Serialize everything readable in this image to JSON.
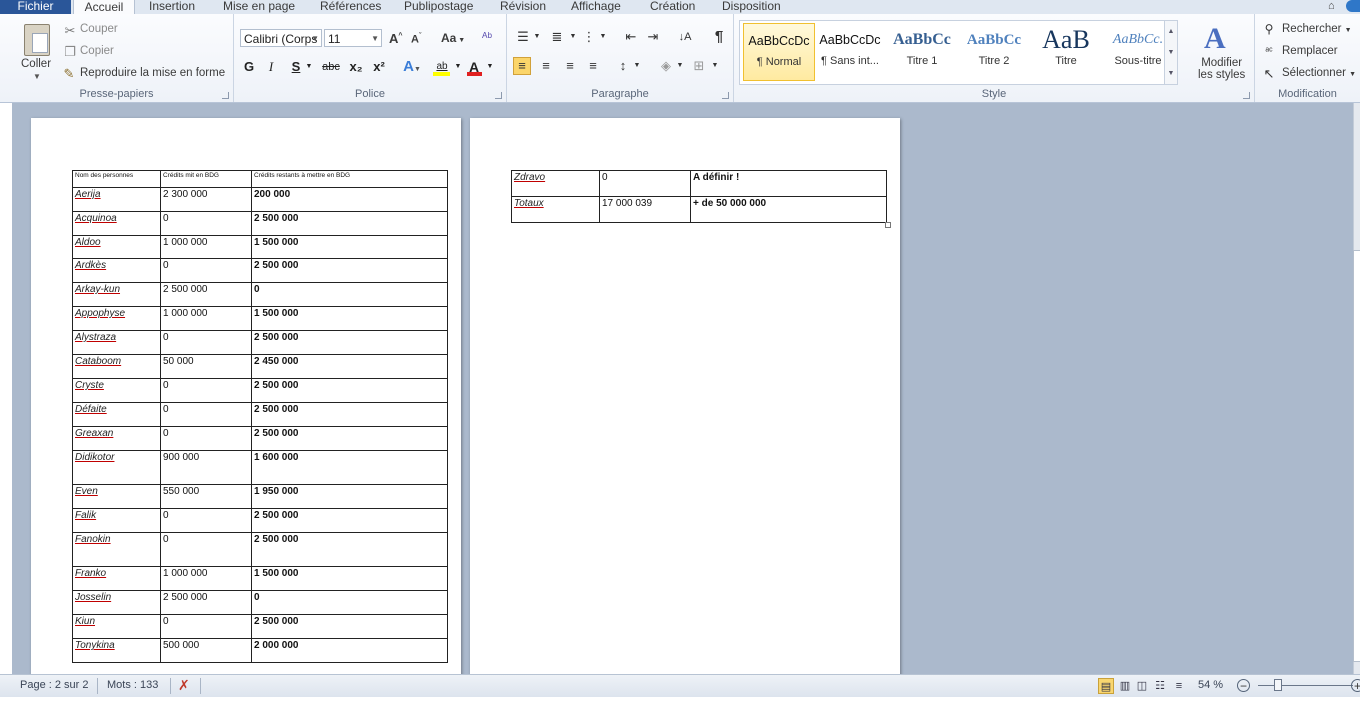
{
  "tabs": {
    "file": "Fichier",
    "home": "Accueil",
    "insert": "Insertion",
    "layout": "Mise en page",
    "references": "Références",
    "mailings": "Publipostage",
    "review": "Révision",
    "view": "Affichage",
    "creation": "Création",
    "disposition": "Disposition"
  },
  "clipboard": {
    "label": "Presse-papiers",
    "paste": "Coller",
    "cut": "Couper",
    "copy": "Copier",
    "format_painter": "Reproduire la mise en forme"
  },
  "font": {
    "label": "Police",
    "family": "Calibri (Corps",
    "size": "11",
    "case_btn": "Aa",
    "bold": "G",
    "italic": "I",
    "underline": "S",
    "strike": "abc",
    "subscript": "x₂",
    "superscript": "x²",
    "highlight_text": "ab",
    "font_color_letter": "A",
    "colors": {
      "highlight": "#ffff00",
      "font_color": "#e02020"
    }
  },
  "paragraph": {
    "label": "Paragraphe",
    "pilcrow": "¶"
  },
  "styles": {
    "label": "Style",
    "items": [
      {
        "preview": "AaBbCcDc",
        "name": "¶ Normal"
      },
      {
        "preview": "AaBbCcDc",
        "name": "¶ Sans int..."
      },
      {
        "preview": "AaBbCc",
        "name": "Titre 1"
      },
      {
        "preview": "AaBbCc",
        "name": "Titre 2"
      },
      {
        "preview": "AaB",
        "name": "Titre"
      },
      {
        "preview": "AaBbCc.",
        "name": "Sous-titre"
      }
    ],
    "change_styles_line1": "Modifier",
    "change_styles_line2": "les styles"
  },
  "editing": {
    "label": "Modification",
    "find": "Rechercher",
    "replace": "Remplacer",
    "select": "Sélectionner"
  },
  "page1_table": {
    "headers": [
      "Nom des personnes",
      "Crédits mit en BDG",
      "Crédits restants à mettre en BDG"
    ],
    "rows": [
      [
        "Aerija",
        "2 300 000",
        "200 000"
      ],
      [
        "Acquinoa",
        "0",
        "2 500 000"
      ],
      [
        "Aldoo",
        "1 000 000",
        "1 500 000"
      ],
      [
        "Ardkès",
        "0",
        "2 500 000"
      ],
      [
        "Arkay-kun",
        "2 500 000",
        "0"
      ],
      [
        "Appophyse",
        "1 000 000",
        "1 500 000"
      ],
      [
        "Alystraza",
        "0",
        "2 500 000"
      ],
      [
        "Cataboom",
        "50 000",
        "2 450 000"
      ],
      [
        "Cryste",
        "0",
        "2 500 000"
      ],
      [
        "Défaite",
        "0",
        "2 500 000"
      ],
      [
        "Greaxan",
        "0",
        "2 500 000"
      ],
      [
        "Didikotor",
        "900 000",
        "1 600 000"
      ],
      [
        "Even",
        "550 000",
        "1 950 000"
      ],
      [
        "Falik",
        "0",
        "2 500 000"
      ],
      [
        "Fanokin",
        "0",
        "2 500 000"
      ],
      [
        "Franko",
        "1 000 000",
        "1 500 000"
      ],
      [
        "Josselin",
        "2 500 000",
        "0"
      ],
      [
        "Kiun",
        "0",
        "2 500 000"
      ],
      [
        "Tonykina",
        "500 000",
        "2 000 000"
      ]
    ]
  },
  "page2_table": {
    "rows": [
      [
        "Zdravo",
        "0",
        "A définir !"
      ],
      [
        "Totaux",
        "17 000 039",
        "+ de 50 000 000"
      ]
    ]
  },
  "status": {
    "page": "Page : 2 sur 2",
    "words": "Mots : 133",
    "zoom": "54 %",
    "zoom_percent": 54
  }
}
